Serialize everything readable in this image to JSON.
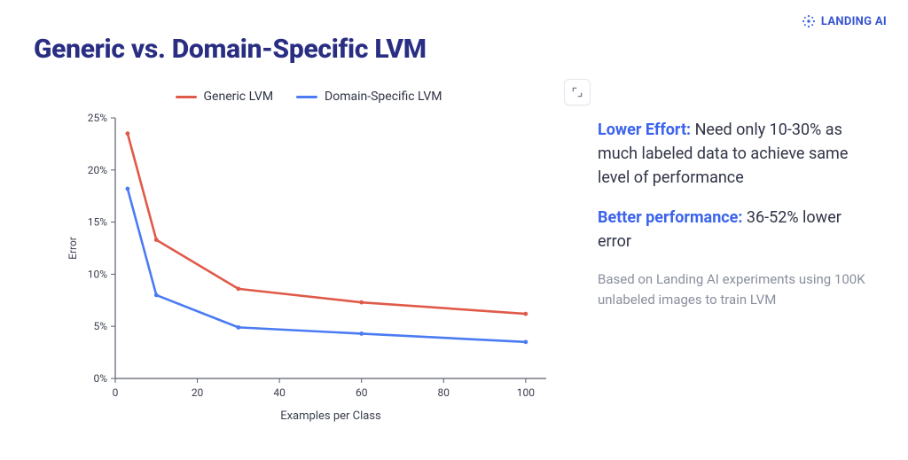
{
  "brand": {
    "name": "LANDING AI"
  },
  "title": "Generic vs. Domain-Specific LVM",
  "sidebar": {
    "effort": {
      "lead": "Lower Effort:",
      "text": " Need only 10-30% as much labeled data to achieve same level of performance"
    },
    "perf": {
      "lead": "Better performance:",
      "text": " 36-52% lower error"
    },
    "footnote": "Based on Landing AI experiments using 100K unlabeled images to train LVM"
  },
  "chart_data": {
    "type": "line",
    "title": "",
    "xlabel": "Examples per Class",
    "ylabel": "Error",
    "xlim": [
      0,
      105
    ],
    "ylim": [
      0,
      25
    ],
    "x_ticks": [
      0,
      20,
      40,
      60,
      80,
      100
    ],
    "y_ticks": [
      0,
      5,
      10,
      15,
      20,
      25
    ],
    "y_tick_labels": [
      "0%",
      "5%",
      "10%",
      "15%",
      "20%",
      "25%"
    ],
    "legend_position": "top-center",
    "x": [
      3,
      10,
      30,
      60,
      100
    ],
    "series": [
      {
        "name": "Generic LVM",
        "color": "#e05a49",
        "values": [
          23.5,
          13.3,
          8.6,
          7.3,
          6.2
        ]
      },
      {
        "name": "Domain-Specific LVM",
        "color": "#4b7bf3",
        "values": [
          18.2,
          8.0,
          4.9,
          4.3,
          3.5
        ]
      }
    ]
  }
}
